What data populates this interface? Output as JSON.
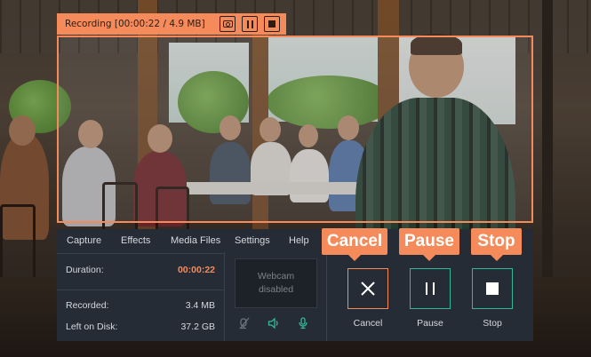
{
  "recording_bar": {
    "title": "Recording [00:00:22 / 4.9 MB]"
  },
  "menu": [
    "Capture",
    "Effects",
    "Media Files",
    "Settings",
    "Help"
  ],
  "stats": {
    "duration_label": "Duration:",
    "duration_value": "00:00:22",
    "recorded_label": "Recorded:",
    "recorded_value": "3.4 MB",
    "disk_label": "Left on Disk:",
    "disk_value": "37.2 GB"
  },
  "webcam": {
    "line1": "Webcam",
    "line2": "disabled"
  },
  "buttons": {
    "cancel": "Cancel",
    "pause": "Pause",
    "stop": "Stop"
  },
  "callouts": {
    "cancel": "Cancel",
    "pause": "Pause",
    "stop": "Stop"
  },
  "icons": {
    "screenshot": "camera-icon",
    "pause": "pause-icon",
    "stop": "stop-icon",
    "webcam_off": "webcam-off-icon",
    "system_audio": "speaker-icon",
    "microphone": "microphone-icon"
  },
  "colors": {
    "accent": "#f58b5b",
    "panel": "#262c35",
    "green": "#35b89a"
  }
}
